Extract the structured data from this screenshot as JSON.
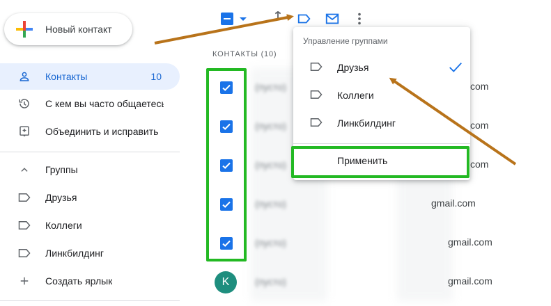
{
  "sidebar": {
    "new_contact_label": "Новый контакт",
    "items": [
      {
        "label": "Контакты",
        "count": "10",
        "icon": "person-icon"
      },
      {
        "label": "С кем вы часто общаетесь",
        "icon": "history-icon"
      },
      {
        "label": "Объединить и исправить",
        "icon": "merge-icon"
      }
    ],
    "groups_header": "Группы",
    "groups": [
      {
        "label": "Друзья",
        "icon": "label-icon"
      },
      {
        "label": "Коллеги",
        "icon": "label-icon"
      },
      {
        "label": "Линкбилдинг",
        "icon": "label-icon"
      }
    ],
    "create_label": "Создать ярлык"
  },
  "toolbar": {
    "icons": [
      "select-all-checkbox",
      "caret-down-icon",
      "merge-icon",
      "label-icon",
      "email-icon",
      "more-vert-icon"
    ]
  },
  "list": {
    "header": "КОНТАКТЫ (10)",
    "rows": [
      {
        "checked": true,
        "name": "(пусто)",
        "email": "com"
      },
      {
        "checked": true,
        "name": "(пусто)",
        "email": "com"
      },
      {
        "checked": true,
        "name": "(пусто)",
        "email": "com"
      },
      {
        "checked": true,
        "name": "(пусто)",
        "email": "gmail.com"
      },
      {
        "checked": true,
        "name": "(пусто)",
        "email": "gmail.com"
      },
      {
        "checked": false,
        "avatar": "K",
        "name": "(пусто)",
        "email": "gmail.com"
      }
    ]
  },
  "group_menu": {
    "title": "Управление группами",
    "options": [
      {
        "label": "Друзья",
        "selected": true
      },
      {
        "label": "Коллеги",
        "selected": false
      },
      {
        "label": "Линкбилдинг",
        "selected": false
      }
    ],
    "apply_label": "Применить"
  },
  "colors": {
    "accent": "#1a73e8",
    "highlight": "#23b923",
    "arrow": "#b8731a",
    "active_bg": "#e8f0fe"
  }
}
